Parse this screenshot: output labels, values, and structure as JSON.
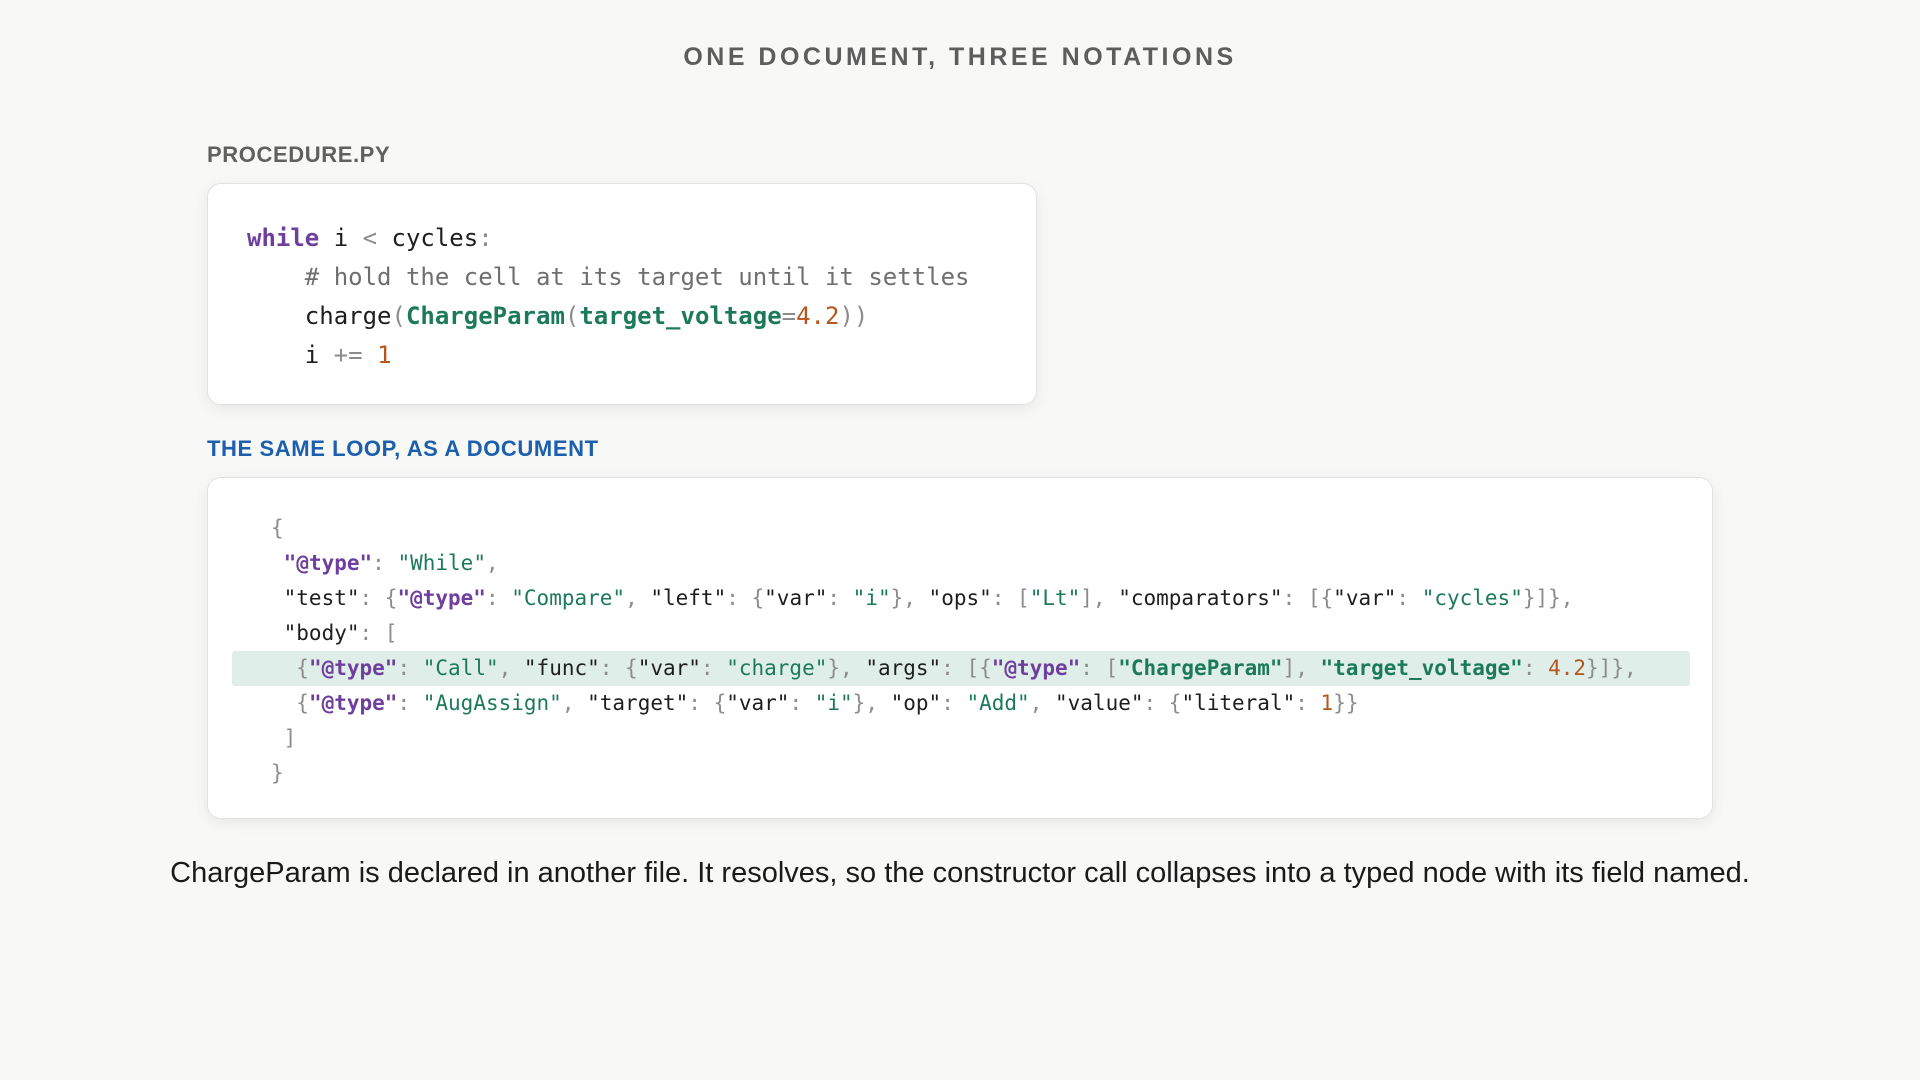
{
  "title": "ONE DOCUMENT, THREE NOTATIONS",
  "python_section": {
    "label": "PROCEDURE.PY",
    "lines": [
      [
        {
          "t": "while",
          "c": "kw"
        },
        {
          "t": " i ",
          "c": "tx"
        },
        {
          "t": "<",
          "c": "pn"
        },
        {
          "t": " cycles",
          "c": "tx"
        },
        {
          "t": ":",
          "c": "pn"
        }
      ],
      [
        {
          "t": "    # hold the cell at its target until it settles",
          "c": "cm"
        }
      ],
      [
        {
          "t": "    charge",
          "c": "tx"
        },
        {
          "t": "(",
          "c": "pn"
        },
        {
          "t": "ChargeParam",
          "c": "gt"
        },
        {
          "t": "(",
          "c": "pn"
        },
        {
          "t": "target_voltage",
          "c": "gt"
        },
        {
          "t": "=",
          "c": "pn"
        },
        {
          "t": "4.2",
          "c": "num"
        },
        {
          "t": "))",
          "c": "pn"
        }
      ],
      [
        {
          "t": "    i ",
          "c": "tx"
        },
        {
          "t": "+=",
          "c": "pn"
        },
        {
          "t": " ",
          "c": "tx"
        },
        {
          "t": "1",
          "c": "num"
        }
      ]
    ]
  },
  "document_section": {
    "label": "THE SAME LOOP, AS A DOCUMENT",
    "highlighted_line": 4,
    "lines": [
      [
        {
          "t": "{",
          "c": "pn"
        }
      ],
      [
        {
          "t": " ",
          "c": "tx"
        },
        {
          "t": "\"@type\"",
          "c": "kw"
        },
        {
          "t": ": ",
          "c": "pn"
        },
        {
          "t": "\"While\"",
          "c": "fg"
        },
        {
          "t": ",",
          "c": "pn"
        }
      ],
      [
        {
          "t": " \"test\"",
          "c": "tx"
        },
        {
          "t": ": {",
          "c": "pn"
        },
        {
          "t": "\"@type\"",
          "c": "kw"
        },
        {
          "t": ": ",
          "c": "pn"
        },
        {
          "t": "\"Compare\"",
          "c": "fg"
        },
        {
          "t": ", ",
          "c": "pn"
        },
        {
          "t": "\"left\"",
          "c": "tx"
        },
        {
          "t": ": {",
          "c": "pn"
        },
        {
          "t": "\"var\"",
          "c": "tx"
        },
        {
          "t": ": ",
          "c": "pn"
        },
        {
          "t": "\"i\"",
          "c": "fg"
        },
        {
          "t": "}, ",
          "c": "pn"
        },
        {
          "t": "\"ops\"",
          "c": "tx"
        },
        {
          "t": ": [",
          "c": "pn"
        },
        {
          "t": "\"Lt\"",
          "c": "fg"
        },
        {
          "t": "], ",
          "c": "pn"
        },
        {
          "t": "\"comparators\"",
          "c": "tx"
        },
        {
          "t": ": [{",
          "c": "pn"
        },
        {
          "t": "\"var\"",
          "c": "tx"
        },
        {
          "t": ": ",
          "c": "pn"
        },
        {
          "t": "\"cycles\"",
          "c": "fg"
        },
        {
          "t": "}]},",
          "c": "pn"
        }
      ],
      [
        {
          "t": " \"body\"",
          "c": "tx"
        },
        {
          "t": ": [",
          "c": "pn"
        }
      ],
      [
        {
          "t": "  {",
          "c": "pn"
        },
        {
          "t": "\"@type\"",
          "c": "kw"
        },
        {
          "t": ": ",
          "c": "pn"
        },
        {
          "t": "\"Call\"",
          "c": "fg"
        },
        {
          "t": ", ",
          "c": "pn"
        },
        {
          "t": "\"func\"",
          "c": "tx"
        },
        {
          "t": ": {",
          "c": "pn"
        },
        {
          "t": "\"var\"",
          "c": "tx"
        },
        {
          "t": ": ",
          "c": "pn"
        },
        {
          "t": "\"charge\"",
          "c": "fg"
        },
        {
          "t": "}, ",
          "c": "pn"
        },
        {
          "t": "\"args\"",
          "c": "tx"
        },
        {
          "t": ": [{",
          "c": "pn"
        },
        {
          "t": "\"@type\"",
          "c": "kw"
        },
        {
          "t": ": [",
          "c": "pn"
        },
        {
          "t": "\"ChargeParam\"",
          "c": "gt"
        },
        {
          "t": "], ",
          "c": "pn"
        },
        {
          "t": "\"target_voltage\"",
          "c": "gt"
        },
        {
          "t": ": ",
          "c": "pn"
        },
        {
          "t": "4.2",
          "c": "num"
        },
        {
          "t": "}]},",
          "c": "pn"
        }
      ],
      [
        {
          "t": "  {",
          "c": "pn"
        },
        {
          "t": "\"@type\"",
          "c": "kw"
        },
        {
          "t": ": ",
          "c": "pn"
        },
        {
          "t": "\"AugAssign\"",
          "c": "fg"
        },
        {
          "t": ", ",
          "c": "pn"
        },
        {
          "t": "\"target\"",
          "c": "tx"
        },
        {
          "t": ": {",
          "c": "pn"
        },
        {
          "t": "\"var\"",
          "c": "tx"
        },
        {
          "t": ": ",
          "c": "pn"
        },
        {
          "t": "\"i\"",
          "c": "fg"
        },
        {
          "t": "}, ",
          "c": "pn"
        },
        {
          "t": "\"op\"",
          "c": "tx"
        },
        {
          "t": ": ",
          "c": "pn"
        },
        {
          "t": "\"Add\"",
          "c": "fg"
        },
        {
          "t": ", ",
          "c": "pn"
        },
        {
          "t": "\"value\"",
          "c": "tx"
        },
        {
          "t": ": {",
          "c": "pn"
        },
        {
          "t": "\"literal\"",
          "c": "tx"
        },
        {
          "t": ": ",
          "c": "pn"
        },
        {
          "t": "1",
          "c": "num"
        },
        {
          "t": "}}",
          "c": "pn"
        }
      ],
      [
        {
          "t": " ]",
          "c": "pn"
        }
      ],
      [
        {
          "t": "}",
          "c": "pn"
        }
      ]
    ]
  },
  "caption": "ChargeParam is declared in another file. It resolves, so the constructor call collapses into a typed node with its field named."
}
